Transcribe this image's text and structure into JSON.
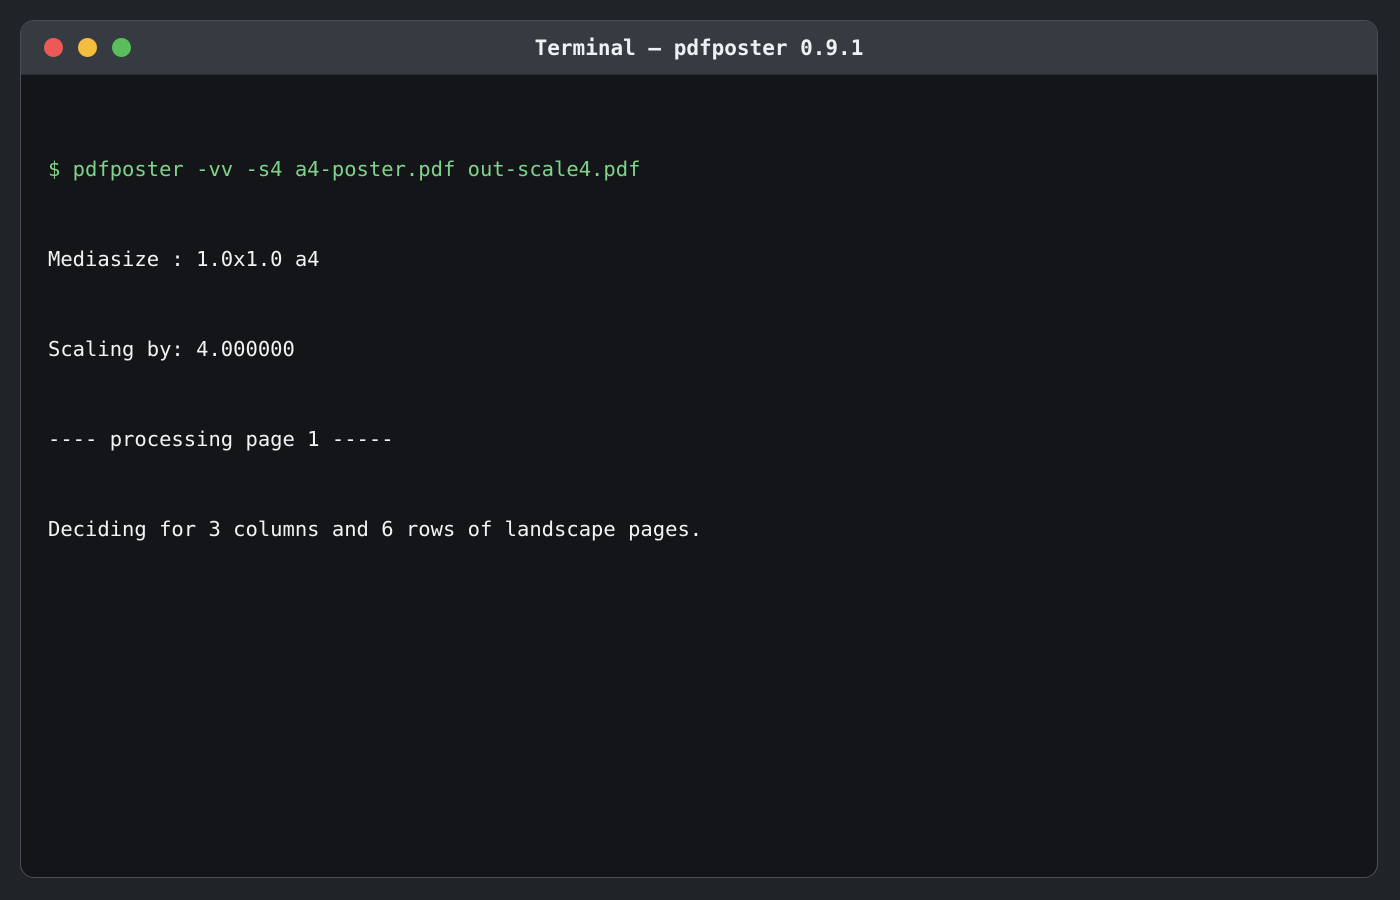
{
  "window": {
    "title": "Terminal — pdfposter 0.9.1",
    "controls": {
      "close_color": "#ec5a55",
      "minimize_color": "#f5bd3d",
      "maximize_color": "#5abf5b"
    }
  },
  "terminal": {
    "prompt_color": "#7fd38a",
    "text_color": "#f2f3f4",
    "lines": [
      "$ pdfposter -vv -s4 a4-poster.pdf out-scale4.pdf",
      "Mediasize : 1.0x1.0 a4",
      "Scaling by: 4.000000",
      "---- processing page 1 -----",
      "Deciding for 3 columns and 6 rows of landscape pages."
    ]
  }
}
